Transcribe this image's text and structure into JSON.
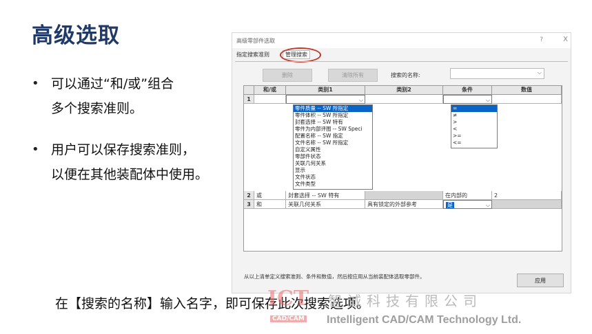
{
  "slide": {
    "title": "高级选取",
    "bullets": [
      {
        "line1": "可以通过“和/或”组合",
        "line2": "多个搜索准则。"
      },
      {
        "line1": "用户可以保存搜索准则，",
        "line2": "以便在其他装配体中使用。"
      }
    ],
    "bullet_symbol": "•",
    "caption": "在【搜索的名称】输入名字，即可保存此次搜索选项。"
  },
  "dialog": {
    "title": "高级零部件选取",
    "help": "?",
    "close": "X",
    "tabs": [
      "指定搜索准则",
      "管理搜索"
    ],
    "delete_label": "删除",
    "clear_all_label": "清除所有",
    "search_name_label": "搜索的名称:",
    "search_name_value": "",
    "columns": [
      "和/或",
      "类别1",
      "类别2",
      "条件",
      "数值"
    ],
    "rows": [
      {
        "num": "1",
        "andor": "",
        "cat1": "",
        "cat2": "",
        "cond": "",
        "value": ""
      },
      {
        "num": "2",
        "andor": "或",
        "cat1": "封套选择 -- SW 特有",
        "cat2": "",
        "cond": "在内部的",
        "value": "2"
      },
      {
        "num": "3",
        "andor": "和",
        "cat1": "关联几何关系",
        "cat2": "具有锁定的外部参考",
        "cond": "是",
        "value": ""
      }
    ],
    "category1_options": [
      "零件质量 -- SW 所指定",
      "零件体积 -- SW 所指定",
      "封套选择 -- SW 特有",
      "零件为内部评图 -- SW Speci",
      "配置名称 -- SW 指定",
      "文件名称 -- SW 所指定",
      "自定义属性",
      "零部件状态",
      "关联几何关系",
      "显示",
      "文件状态",
      "文件类型"
    ],
    "condition_options": [
      "=",
      "≠",
      ">",
      "<",
      ">=",
      "<="
    ],
    "instruction": "从以上清单定义搜索准则、条件和数值，然后按应用从当前装配体选取零部件。",
    "apply_label": "应用"
  },
  "watermark": {
    "logo_text": "ICT",
    "logo_sub": "CAD/CAM",
    "company_cn": "智诚科技有限公司",
    "company_en": "Intelligent CAD/CAM Technology Ltd."
  },
  "colors": {
    "title": "#1f3a68",
    "highlight_circle": "#c0392b",
    "selection": "#0a64c8",
    "watermark": "#e86a6a"
  }
}
